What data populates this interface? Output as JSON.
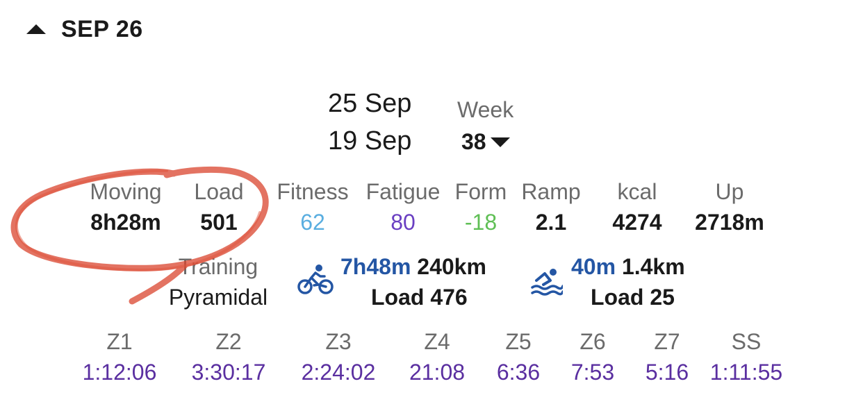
{
  "header": {
    "date": "SEP 26"
  },
  "week": {
    "end_date": "25 Sep",
    "start_date": "19 Sep",
    "label": "Week",
    "number": "38"
  },
  "stats": [
    {
      "label": "Moving",
      "value": "8h28m"
    },
    {
      "label": "Load",
      "value": "501"
    },
    {
      "label": "Fitness",
      "value": "62"
    },
    {
      "label": "Fatigue",
      "value": "80"
    },
    {
      "label": "Form",
      "value": "-18"
    },
    {
      "label": "Ramp",
      "value": "2.1"
    },
    {
      "label": "kcal",
      "value": "4274"
    },
    {
      "label": "Up",
      "value": "2718m"
    }
  ],
  "training": {
    "label": "Training",
    "value": "Pyramidal"
  },
  "ride": {
    "icon": "bicycle-icon",
    "time": "7h48m",
    "distance": "240km",
    "load": "Load 476"
  },
  "swim": {
    "icon": "swimmer-icon",
    "time": "40m",
    "distance": "1.4km",
    "load": "Load 25"
  },
  "zones": [
    {
      "label": "Z1",
      "value": "1:12:06"
    },
    {
      "label": "Z2",
      "value": "3:30:17"
    },
    {
      "label": "Z3",
      "value": "2:24:02"
    },
    {
      "label": "Z4",
      "value": "21:08"
    },
    {
      "label": "Z5",
      "value": "6:36"
    },
    {
      "label": "Z6",
      "value": "7:53"
    },
    {
      "label": "Z7",
      "value": "5:16"
    },
    {
      "label": "SS",
      "value": "1:11:55"
    }
  ],
  "colors": {
    "fitness": "#5aaee0",
    "fatigue": "#6a3fc2",
    "form": "#5fbf55",
    "activity": "#2456a4",
    "zones": "#5a2fa0",
    "annotation": "#d9442e"
  }
}
